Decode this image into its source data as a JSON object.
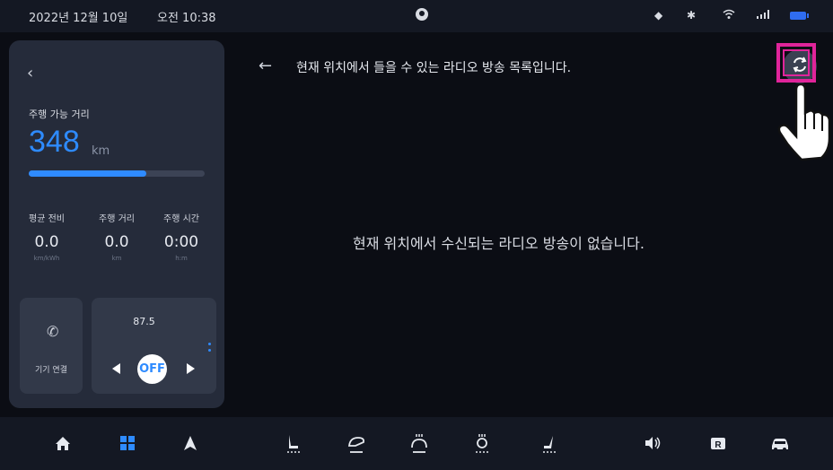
{
  "status_bar": {
    "date": "2022년 12월 10일",
    "time": "오전 10:38",
    "icons": [
      "user-icon",
      "bell-icon",
      "bluetooth-icon",
      "wifi-icon",
      "signal-icon",
      "battery-icon"
    ]
  },
  "left_panel": {
    "back_icon": "chevron-left-icon",
    "range_label": "주행 가능 거리",
    "range_value": "348",
    "range_unit": "km",
    "range_fraction": 0.67,
    "stats": [
      {
        "label": "평균 전비",
        "value": "0.0",
        "unit": "km/kWh"
      },
      {
        "label": "주행 거리",
        "value": "0.0",
        "unit": "km"
      },
      {
        "label": "주행 시간",
        "value": "0:00",
        "unit": "h:m"
      }
    ],
    "phone_card": {
      "icon": "phone-icon",
      "label": "기기 연결"
    },
    "radio_card": {
      "frequency": "87.5",
      "power_label": "OFF"
    }
  },
  "main": {
    "back_icon": "arrow-left-icon",
    "title": "현재 위치에서 들을 수 있는 라디오 방송 목록입니다.",
    "empty_message": "현재 위치에서 수신되는 라디오 방송이 없습니다.",
    "refresh_icon": "refresh-icon",
    "highlight_color": "#e0249a"
  },
  "bottom_nav": [
    "home-icon",
    "apps-grid-icon",
    "navigation-arrow-icon",
    "seat-icon",
    "wiper-icon",
    "heated-steering-icon",
    "heated-seat-icon",
    "seat-recline-icon",
    "volume-icon",
    "camera-r-icon",
    "car-icon"
  ],
  "colors": {
    "accent": "#2e8bff",
    "background": "#0b0d14",
    "panel": "#252b3a"
  }
}
